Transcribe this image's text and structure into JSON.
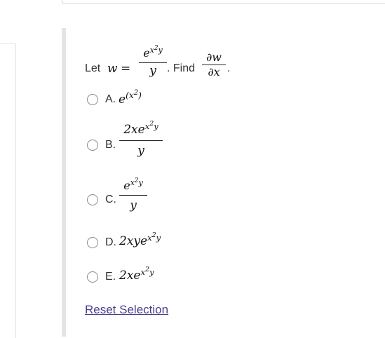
{
  "question": {
    "prefix": "Let",
    "w_var": "w",
    "equals": "=",
    "frac_num_base": "e",
    "frac_num_exp": "x",
    "frac_num_exp2": "2",
    "frac_num_exp3": "y",
    "frac_den": "y",
    "find_text": ". Find",
    "partial_num": "∂w",
    "partial_den": "∂x",
    "end_period": "."
  },
  "options": [
    {
      "letter": "A.",
      "label_base": "e",
      "exp_open": "(x",
      "exp_sq": "2",
      "exp_close": ")"
    },
    {
      "letter": "B.",
      "num_coef": "2xe",
      "exp_x": "x",
      "exp_sq": "2",
      "exp_y": "y",
      "den": "y"
    },
    {
      "letter": "C.",
      "num_base": "e",
      "exp_x": "x",
      "exp_sq": "2",
      "exp_y": "y",
      "den": "y"
    },
    {
      "letter": "D.",
      "base": "2xye",
      "exp_x": "x",
      "exp_sq": "2",
      "exp_y": "y"
    },
    {
      "letter": "E.",
      "base": "2xe",
      "exp_x": "x",
      "exp_sq": "2",
      "exp_y": "y"
    }
  ],
  "reset_label": "Reset Selection"
}
